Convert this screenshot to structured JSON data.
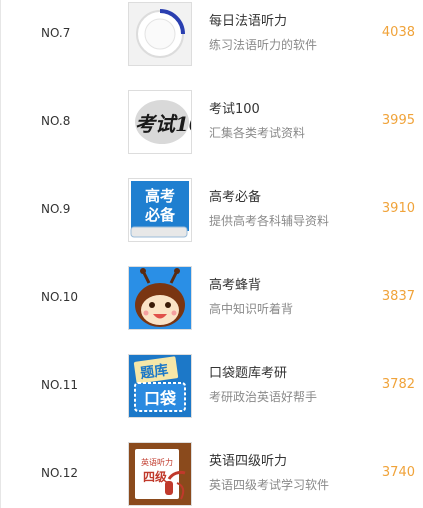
{
  "apps": [
    {
      "rank": "NO.7",
      "name": "每日法语听力",
      "desc": "练习法语听力的软件",
      "count": "4038",
      "icon": "clock-dial-icon"
    },
    {
      "rank": "NO.8",
      "name": "考试100",
      "desc": "汇集各类考试资料",
      "count": "3995",
      "icon": "kaoshi-100-logo-icon",
      "icon_text": "考试100"
    },
    {
      "rank": "NO.9",
      "name": "高考必备",
      "desc": "提供高考各科辅导资料",
      "count": "3910",
      "icon": "gaokao-book-icon",
      "icon_text": [
        "高考",
        "必备"
      ]
    },
    {
      "rank": "NO.10",
      "name": "高考蜂背",
      "desc": "高中知识听着背",
      "count": "3837",
      "icon": "bee-mascot-icon"
    },
    {
      "rank": "NO.11",
      "name": "口袋题库考研",
      "desc": "考研政治英语好帮手",
      "count": "3782",
      "icon": "pocket-question-bank-icon",
      "icon_text": [
        "题库",
        "口袋"
      ]
    },
    {
      "rank": "NO.12",
      "name": "英语四级听力",
      "desc": "英语四级考试学习软件",
      "count": "3740",
      "icon": "cet4-headphones-book-icon",
      "icon_text": [
        "英语听力",
        "四级"
      ]
    }
  ],
  "colors": {
    "count": "#f0a33a",
    "name": "#333333",
    "desc": "#8a8a8a",
    "rank": "#333333",
    "blue": "#1f7fd0"
  }
}
